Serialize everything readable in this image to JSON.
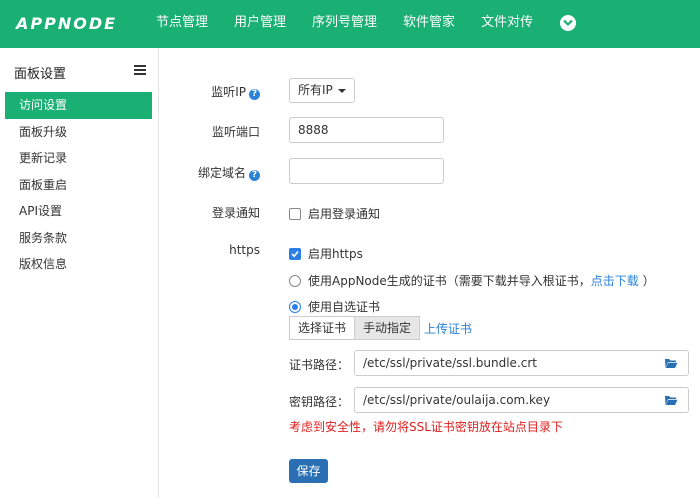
{
  "header": {
    "logo": "APPNODE",
    "nav": [
      "节点管理",
      "用户管理",
      "序列号管理",
      "软件管家",
      "文件对传"
    ]
  },
  "sidebar": {
    "title": "面板设置",
    "items": [
      "访问设置",
      "面板升级",
      "更新记录",
      "面板重启",
      "API设置",
      "服务条款",
      "版权信息"
    ],
    "active_index": 0
  },
  "form": {
    "listen_ip_label": "监听IP",
    "listen_ip_value": "所有IP",
    "listen_port_label": "监听端口",
    "listen_port_value": "8888",
    "bind_domain_label": "绑定域名",
    "bind_domain_value": "",
    "login_notify_label": "登录通知",
    "login_notify_option": "启用登录通知",
    "https_label": "https",
    "https_enable_option": "启用https",
    "cert_option_1_text": "使用AppNode生成的证书（需要下载并导入根证书，",
    "cert_option_1_link": "点击下载",
    "cert_option_1_tail": "）",
    "cert_option_2_text": "使用自选证书",
    "tab_select": "选择证书",
    "tab_manual": "手动指定",
    "tab_upload": "上传证书",
    "cert_path_label": "证书路径：",
    "cert_path_value": "/etc/ssl/private/ssl.bundle.crt",
    "key_path_label": "密钥路径：",
    "key_path_value": "/etc/ssl/private/oulaija.com.key",
    "warning": "考虑到安全性，请勿将SSL证书密钥放在站点目录下",
    "save_label": "保存"
  },
  "colors": {
    "brand": "#1aaf73",
    "primary": "#2a6fb3",
    "link": "#2b82d9",
    "warning": "#e02020"
  },
  "icons": {
    "help": "question-circle-icon",
    "folder": "folder-open-icon",
    "menu": "hamburger-icon",
    "more": "chevron-down-icon"
  }
}
